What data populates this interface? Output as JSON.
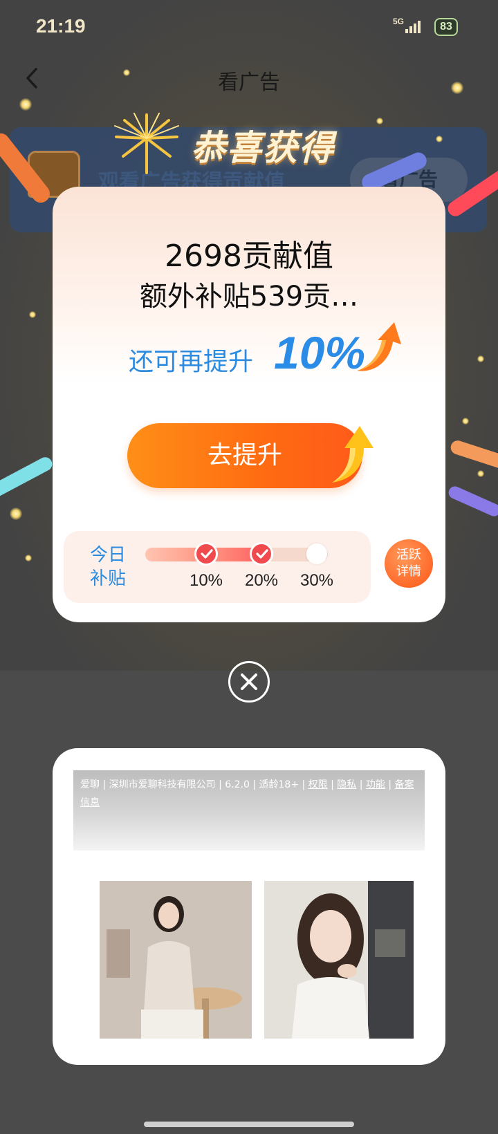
{
  "status_bar": {
    "time": "21:19",
    "network": "5G",
    "battery": "83"
  },
  "nav": {
    "title": "看广告",
    "back_icon": "chevron-left-icon"
  },
  "background_card": {
    "text": "观看广告获得贡献值",
    "button": "看广告"
  },
  "congrats": {
    "title": "恭喜获得",
    "icon": "fireworks-icon"
  },
  "popup": {
    "amount": "2698贡献值",
    "extra": "额外补贴539贡…",
    "boost_label": "还可再提升",
    "boost_value": "10%",
    "boost_button": "去提升",
    "subsidy_label_line1": "今日",
    "subsidy_label_line2": "补贴",
    "progress": {
      "steps": [
        "10%",
        "20%",
        "30%"
      ],
      "completed_steps": 2
    },
    "active_line1": "活跃",
    "active_line2": "详情"
  },
  "ad": {
    "info_line1_parts": [
      "爱聊",
      "深圳市爱聊科技有限公司",
      "6.2.0",
      "适龄18+"
    ],
    "links": [
      "权限",
      "隐私",
      "功能",
      "备案信息"
    ],
    "separator": "|"
  },
  "colors": {
    "accent_blue": "#2b8be0",
    "button_orange": "#ff6a12",
    "check_red": "#f04a4f"
  }
}
